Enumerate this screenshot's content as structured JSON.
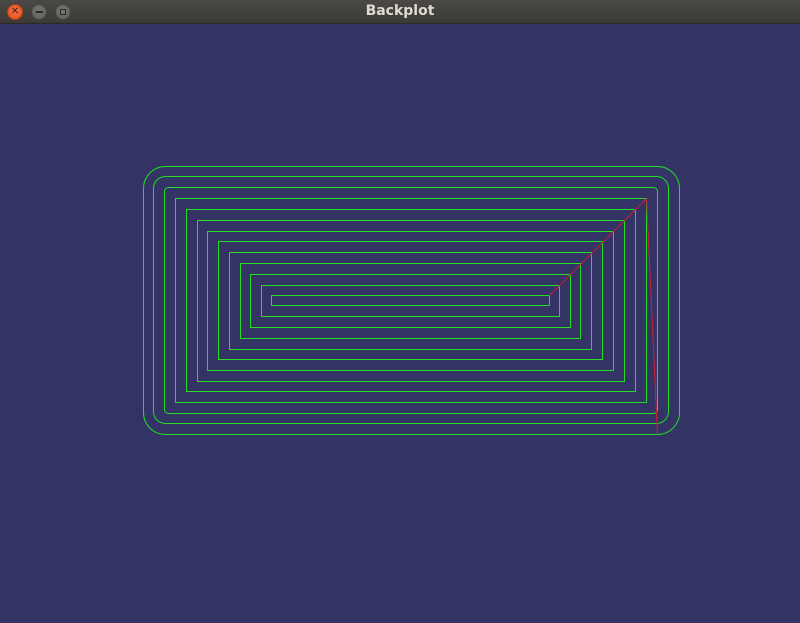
{
  "window": {
    "title": "Backplot",
    "controls": {
      "close_icon": "close-icon",
      "minimize_icon": "minimize-icon",
      "maximize_icon": "maximize-icon"
    }
  },
  "plot": {
    "background_color": "#333366",
    "toolpath_color": "#22dd22",
    "rapid_color": "#cc2233"
  }
}
